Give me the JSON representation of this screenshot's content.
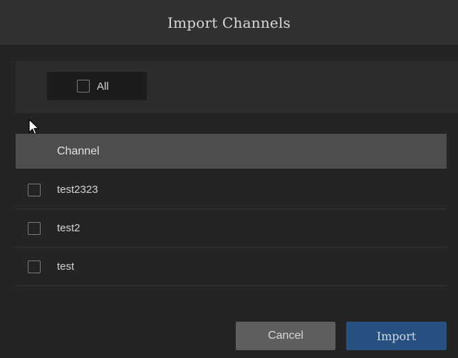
{
  "dialog": {
    "title": "Import Channels"
  },
  "filter": {
    "all_label": "All",
    "all_checked": false
  },
  "table": {
    "header": "Channel",
    "rows": [
      {
        "label": "test2323",
        "checked": false
      },
      {
        "label": "test2",
        "checked": false
      },
      {
        "label": "test",
        "checked": false
      }
    ]
  },
  "buttons": {
    "cancel_label": "Cancel",
    "import_label": "Import"
  },
  "colors": {
    "title_bar": "#313131",
    "background": "#242424",
    "header": "#4d4d4d",
    "cancel": "#5e5e5e",
    "import": "#25507f"
  },
  "icons": {
    "cursor": "mouse-pointer-icon"
  }
}
